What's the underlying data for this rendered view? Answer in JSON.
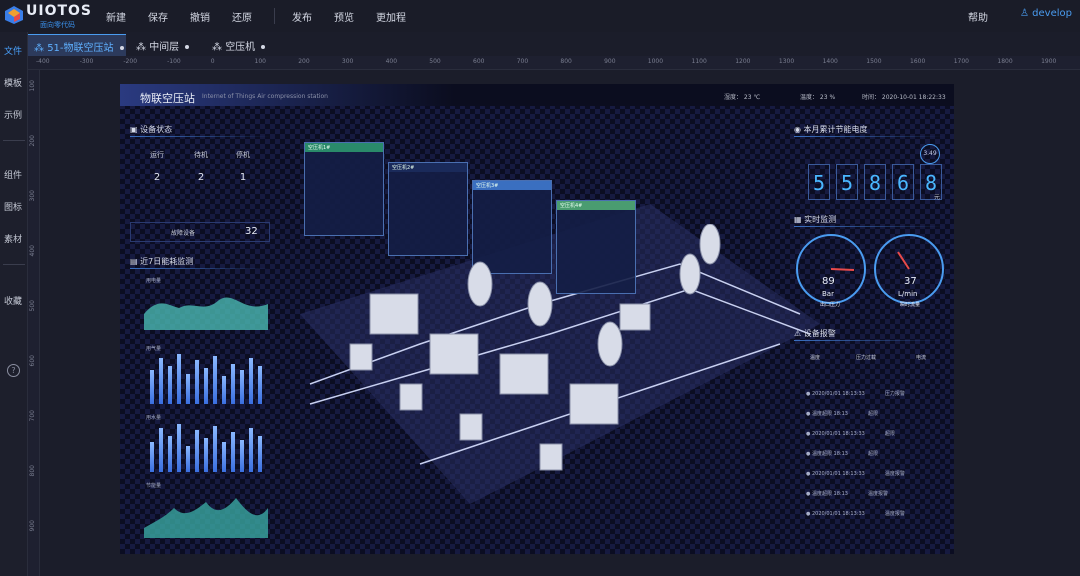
{
  "brand": {
    "name": "UIOTOS",
    "sub": "面向零代码"
  },
  "menu": [
    "新建",
    "保存",
    "撤销",
    "还原",
    "发布",
    "预览",
    "更加程"
  ],
  "help": "帮助",
  "user": "develop",
  "rail": [
    "文件",
    "模板",
    "示例",
    "组件",
    "图标",
    "素材",
    "收藏"
  ],
  "tabs": [
    "51-物联空压站",
    "中间层",
    "空压机"
  ],
  "ruler": [
    "-400",
    "-300",
    "-200",
    "-100",
    "0",
    "100",
    "200",
    "300",
    "400",
    "500",
    "600",
    "700",
    "800",
    "900",
    "1000",
    "1100",
    "1200",
    "1300",
    "1400",
    "1500",
    "1600",
    "1700",
    "1800",
    "1900"
  ],
  "rulerV": [
    "100",
    "200",
    "300",
    "400",
    "500",
    "600",
    "700",
    "800",
    "900"
  ],
  "scene": {
    "title": "物联空压站",
    "subtitle": "Internet of Things Air compression station",
    "stats": [
      "湿度： 23 ℃",
      "温度： 23 %",
      "时间： 2020-10-01 18:22:33"
    ]
  },
  "device_status": {
    "title": "设备状态",
    "items": [
      {
        "label": "运行",
        "value": "2"
      },
      {
        "label": "待机",
        "value": "2"
      },
      {
        "label": "停机",
        "value": "1"
      }
    ],
    "alarm_label": "故障设备",
    "alarm_value": "32"
  },
  "energy": {
    "title": "近7日能耗监测",
    "charts": [
      "用电量",
      "用气量",
      "用水量",
      "节能量"
    ]
  },
  "popups": [
    "空压机1#",
    "空压机2#",
    "空压机3#",
    "空压机4#"
  ],
  "meter": {
    "title": "本月累计节能电度",
    "digits": [
      "5",
      "5",
      "8",
      "6",
      "8"
    ],
    "unit": "元",
    "badge": "3.49"
  },
  "realtime": {
    "title": "实时监测",
    "g1": {
      "value": "89",
      "unit": "Bar",
      "label": "出口压力"
    },
    "g2": {
      "value": "37",
      "unit": "L/min",
      "label": "瞬时流量"
    }
  },
  "alarms": {
    "title": "设备报警",
    "legend": [
      "温度",
      "压力过载",
      "电流"
    ],
    "rows": [
      [
        "2020/01/01 18:13:33",
        "压力报警"
      ],
      [
        "温度超限  18:13",
        "超限"
      ],
      [
        "2020/01/01 18:13:33",
        "超限"
      ],
      [
        "温度超限  18:13",
        "超限"
      ],
      [
        "2020/01/01 18:13:33",
        "温度报警"
      ],
      [
        "温度超限  18:13",
        "温度报警"
      ],
      [
        "2020/01/01 18:13:33",
        "温度报警"
      ]
    ]
  },
  "colors": {
    "accent": "#4a9cf0",
    "panel": "#0b0d1f"
  }
}
